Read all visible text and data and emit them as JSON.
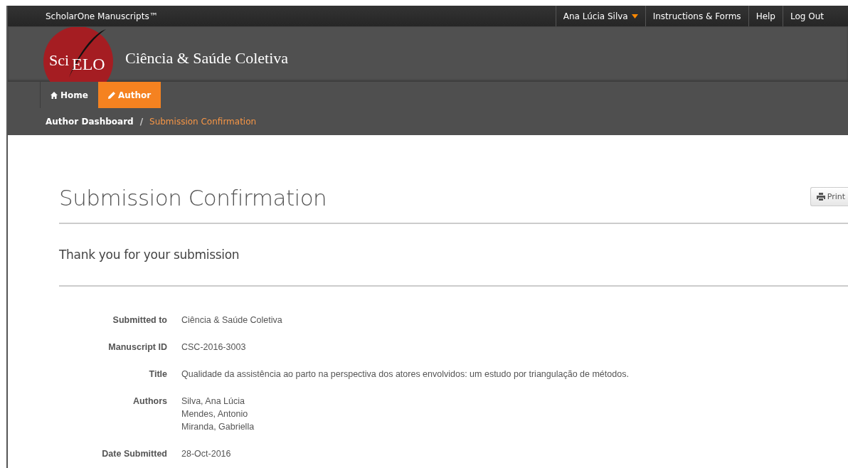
{
  "top_bar": {
    "product": "ScholarOne Manuscripts™",
    "user_menu": {
      "label": "Ana Lúcia Silva"
    },
    "links": [
      "Instructions & Forms",
      "Help",
      "Log Out"
    ]
  },
  "header": {
    "logo": {
      "part_1": "Sci",
      "part_2": "ELO"
    },
    "journal": "Ciência & Saúde Coletiva"
  },
  "nav_tabs": [
    {
      "label": "Home",
      "kind": "home",
      "selected": false
    },
    {
      "label": "Author",
      "kind": "author",
      "selected": true
    }
  ],
  "breadcrumb_separator": "/",
  "breadcrumb": [
    {
      "label": "Author Dashboard",
      "selected": false
    },
    {
      "label": "Submission Confirmation",
      "selected": true
    }
  ],
  "page": {
    "title": "Submission Confirmation",
    "print_button": "Print",
    "subtitle": "Thank you for your submission",
    "fields": [
      {
        "label": "Submitted to",
        "values": [
          "Ciência & Saúde Coletiva"
        ]
      },
      {
        "label": "Manuscript ID",
        "values": [
          "CSC-2016-3003"
        ]
      },
      {
        "label": "Title",
        "values": [
          "Qualidade da assistência ao parto na perspectiva dos atores envolvidos: um estudo por triangulação de métodos."
        ]
      },
      {
        "label": "Authors",
        "values": [
          "Silva, Ana Lúcia",
          "Mendes, Antonio",
          "Miranda, Gabriella"
        ]
      },
      {
        "label": "Date Submitted",
        "values": [
          "28-Oct-2016"
        ]
      }
    ]
  }
}
